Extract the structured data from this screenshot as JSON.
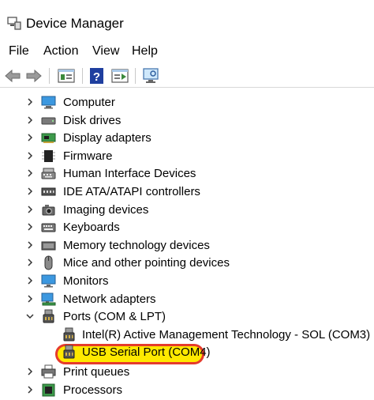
{
  "window": {
    "title": "Device Manager"
  },
  "menu": [
    "File",
    "Action",
    "View",
    "Help"
  ],
  "toolbar": {
    "buttons": [
      "back-icon",
      "forward-icon",
      "properties-icon",
      "help-icon",
      "update-driver-icon",
      "scan-hardware-icon"
    ]
  },
  "tree": {
    "items": [
      {
        "label": "Computer",
        "icon": "computer-icon",
        "expanded": false
      },
      {
        "label": "Disk drives",
        "icon": "disk-drive-icon",
        "expanded": false
      },
      {
        "label": "Display adapters",
        "icon": "display-adapter-icon",
        "expanded": false
      },
      {
        "label": "Firmware",
        "icon": "firmware-icon",
        "expanded": false
      },
      {
        "label": "Human Interface Devices",
        "icon": "hid-icon",
        "expanded": false
      },
      {
        "label": "IDE ATA/ATAPI controllers",
        "icon": "ide-controller-icon",
        "expanded": false
      },
      {
        "label": "Imaging devices",
        "icon": "camera-icon",
        "expanded": false
      },
      {
        "label": "Keyboards",
        "icon": "keyboard-icon",
        "expanded": false
      },
      {
        "label": "Memory technology devices",
        "icon": "memory-icon",
        "expanded": false
      },
      {
        "label": "Mice and other pointing devices",
        "icon": "mouse-icon",
        "expanded": false
      },
      {
        "label": "Monitors",
        "icon": "monitor-icon",
        "expanded": false
      },
      {
        "label": "Network adapters",
        "icon": "network-adapter-icon",
        "expanded": false
      },
      {
        "label": "Ports (COM & LPT)",
        "icon": "port-icon",
        "expanded": true
      },
      {
        "label": "Intel(R) Active Management Technology - SOL (COM3)",
        "icon": "port-icon",
        "child": true
      },
      {
        "label": "USB Serial Port (COM4)",
        "icon": "port-icon",
        "child": true,
        "highlighted": true
      },
      {
        "label": "Print queues",
        "icon": "printer-icon",
        "expanded": false
      },
      {
        "label": "Processors",
        "icon": "processor-icon",
        "expanded": false
      }
    ]
  },
  "colors": {
    "highlight_fill": "#ffe900",
    "highlight_border": "#e53b2c"
  }
}
